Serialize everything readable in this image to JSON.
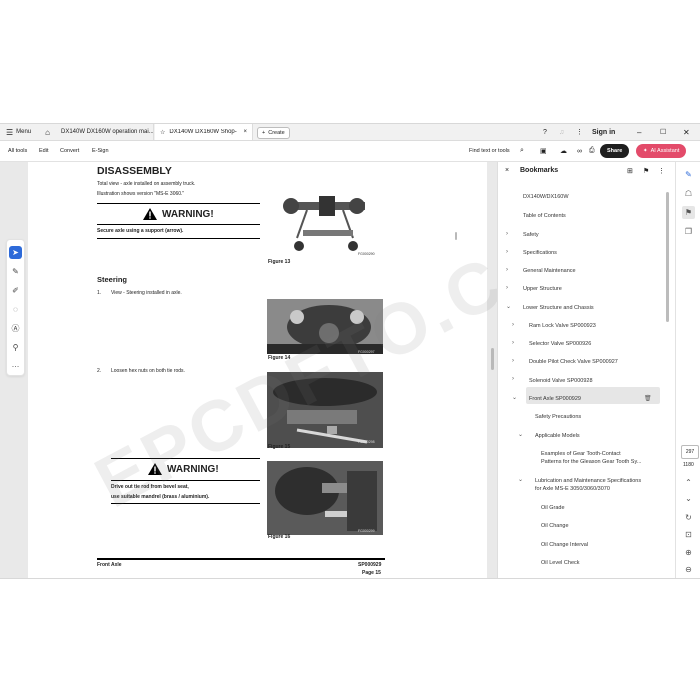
{
  "tabs": {
    "menu_label": "Menu",
    "tab1": "DX140W DX160W operation mai...",
    "tab2": "DX140W DX160W Shop-...",
    "create": "Create",
    "sign_in": "Sign in"
  },
  "toolbar": {
    "all_tools": "All tools",
    "edit": "Edit",
    "convert": "Convert",
    "esign": "E-Sign",
    "find": "Find text or tools",
    "share": "Share",
    "ai_assistant": "AI Assistant"
  },
  "page": {
    "title": "DISASSEMBLY",
    "intro1": "Total view - axle installed on assembly truck.",
    "intro2": "Illustration shows version \"MS-E 3060.\"",
    "warning1": "WARNING!",
    "warning1_text": "Secure axle using a support (arrow).",
    "fig13": "Figure 13",
    "fig13_code": "FG000290",
    "steering": "Steering",
    "step1_num": "1.",
    "step1": "View - Steering installed in axle.",
    "fig14": "Figure 14",
    "fig14_code": "FG000297",
    "step2_num": "2.",
    "step2": "Loosen hex nuts on both tie rods.",
    "fig15": "Figure 15",
    "fig15_code": "FG000298",
    "warning2": "WARNING!",
    "warning2_line1": "Drive out tie rod from bevel seat,",
    "warning2_line2": "use suitable mandrel (brass / aluminium).",
    "fig16": "Figure 16",
    "fig16_code": "FG000299",
    "footer_left": "Front Axle",
    "footer_right": "SP000929",
    "footer_page": "Page 15",
    "watermark": "EPCDFTO.COM"
  },
  "bookmarks": {
    "title": "Bookmarks",
    "items": [
      "DX140W/DX160W",
      "Table of Contents",
      "Safety",
      "Specifications",
      "General Maintenance",
      "Upper Structure",
      "Lower Structure and Chassis",
      "Ram Lock Valve SP000923",
      "Selector Valve SP000926",
      "Double Pilot Check Valve SP000927",
      "Solenoid Valve SP000928",
      "Front Axle SP000929",
      "Safety Precautions",
      "Applicable Models",
      "Examples of Gear Tooth-Contact",
      "Patterns for the Gleason Gear Tooth Sy...",
      "Lubrication and Maintenance Specifications",
      "for Axle MS-E 3050/3060/3070",
      "Oil Grade",
      "Oil Change",
      "Oil Change Interval",
      "Oil Level Check"
    ]
  },
  "pager": {
    "current": "297",
    "total": "1180"
  },
  "colors": {
    "ai_button": "#e34b6a",
    "selected_tool": "#2d6ad9",
    "share_button": "#1e1e1e"
  },
  "icons": [
    "hamburger-icon",
    "home-icon",
    "star-icon",
    "close-icon",
    "plus-icon",
    "help-icon",
    "bell-icon",
    "minimize-icon",
    "maximize-icon",
    "window-close-icon",
    "save-icon",
    "cloud-upload-icon",
    "link-icon",
    "print-icon",
    "select-arrow-icon",
    "comment-icon",
    "pen-icon",
    "lasso-icon",
    "text-select-icon",
    "stamp-icon",
    "more-icon",
    "bookmark-add-icon",
    "bookmark-icon",
    "more-vertical-icon",
    "chevron-right-icon",
    "chevron-down-icon",
    "trash-icon",
    "edit-panel-icon",
    "chat-icon",
    "bookmarks-panel-icon",
    "copy-icon",
    "chevron-up-icon",
    "refresh-icon",
    "zoom-in-icon",
    "zoom-out-icon"
  ]
}
